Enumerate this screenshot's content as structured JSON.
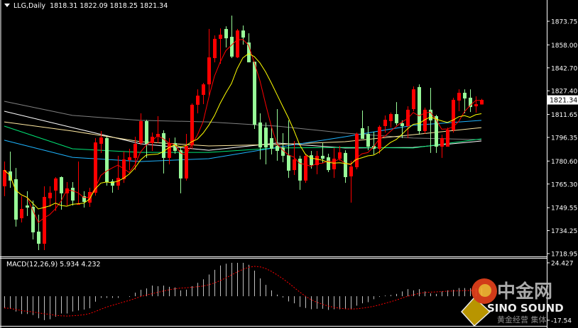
{
  "header": {
    "symbol": "LLG,Daily",
    "ohlc_text": "1818.31 1822.09 1818.25 1821.34"
  },
  "macd_label": "MACD(12,26,9) 5.934 4.232",
  "watermark": {
    "cn": "中金网",
    "en": "SINO SOUND",
    "sub": "黄金经营 集体"
  },
  "colors": {
    "background": "#000000",
    "bull_candle": "#ff0000",
    "bear_candle": "#98fb98",
    "ma_fast": "#ff0000",
    "ma_slow": "#ffff00",
    "ma_blue": "#1eb4ff",
    "ma_green": "#00e676",
    "ma_cream": "#ffe9a0",
    "ma_white": "#ffffff",
    "ma_gray": "#808080",
    "macd_hist": "#c0c0c0",
    "macd_signal": "#ff0000"
  },
  "chart_data": [
    {
      "type": "candlestick",
      "title": "LLG,Daily",
      "current_price": "1821.34",
      "y_ticks": [
        "1873.75",
        "1858.00",
        "1842.70",
        "1827.40",
        "1811.65",
        "1796.35",
        "1780.60",
        "1765.30",
        "1749.55",
        "1734.25",
        "1718.95"
      ],
      "ylim": [
        1718.95,
        1873.75
      ],
      "grid": false,
      "ohlc": [
        [
          1763.8,
          1780.3,
          1757.2,
          1774.6
        ],
        [
          1773.7,
          1786.9,
          1762.8,
          1767.6
        ],
        [
          1768.5,
          1776.0,
          1736.9,
          1741.6
        ],
        [
          1742.5,
          1757.2,
          1739.7,
          1748.7
        ],
        [
          1751.0,
          1760.5,
          1744.0,
          1749.6
        ],
        [
          1750.1,
          1754.3,
          1728.4,
          1733.1
        ],
        [
          1733.6,
          1744.9,
          1721.3,
          1725.5
        ],
        [
          1725.5,
          1763.8,
          1721.3,
          1756.7
        ],
        [
          1755.8,
          1763.8,
          1750.1,
          1759.5
        ],
        [
          1760.9,
          1769.9,
          1747.3,
          1769.0
        ],
        [
          1769.9,
          1770.4,
          1748.2,
          1759.1
        ],
        [
          1759.1,
          1766.6,
          1751.0,
          1762.4
        ],
        [
          1762.8,
          1766.6,
          1751.0,
          1754.3
        ],
        [
          1751.5,
          1780.3,
          1751.5,
          1752.4
        ],
        [
          1757.2,
          1760.5,
          1749.6,
          1753.4
        ],
        [
          1752.9,
          1762.8,
          1750.1,
          1760.0
        ],
        [
          1759.5,
          1795.9,
          1757.6,
          1793.0
        ],
        [
          1792.1,
          1800.6,
          1786.0,
          1796.3
        ],
        [
          1795.9,
          1796.8,
          1764.2,
          1766.6
        ],
        [
          1767.1,
          1768.5,
          1759.5,
          1764.2
        ],
        [
          1764.2,
          1784.1,
          1761.4,
          1769.4
        ],
        [
          1768.5,
          1786.9,
          1766.1,
          1781.7
        ],
        [
          1781.2,
          1788.8,
          1774.6,
          1783.1
        ],
        [
          1782.7,
          1796.8,
          1774.6,
          1792.1
        ],
        [
          1792.6,
          1812.4,
          1791.2,
          1807.2
        ],
        [
          1807.2,
          1808.1,
          1782.7,
          1792.1
        ],
        [
          1792.6,
          1799.6,
          1787.4,
          1796.8
        ],
        [
          1796.8,
          1810.5,
          1792.6,
          1798.7
        ],
        [
          1799.2,
          1801.1,
          1772.3,
          1782.7
        ],
        [
          1782.7,
          1795.9,
          1778.4,
          1792.6
        ],
        [
          1792.6,
          1796.3,
          1785.5,
          1787.4
        ],
        [
          1787.8,
          1790.2,
          1759.1,
          1769.0
        ],
        [
          1769.0,
          1798.7,
          1767.6,
          1790.7
        ],
        [
          1791.2,
          1819.0,
          1788.8,
          1818.1
        ],
        [
          1818.1,
          1828.4,
          1812.4,
          1824.2
        ],
        [
          1824.7,
          1832.7,
          1818.5,
          1831.7
        ],
        [
          1831.7,
          1868.6,
          1824.2,
          1849.7
        ],
        [
          1849.2,
          1864.3,
          1846.4,
          1862.0
        ],
        [
          1862.0,
          1869.0,
          1845.4,
          1864.8
        ],
        [
          1868.6,
          1870.4,
          1856.3,
          1862.4
        ],
        [
          1863.4,
          1877.5,
          1849.2,
          1850.2
        ],
        [
          1849.7,
          1868.6,
          1849.2,
          1867.6
        ],
        [
          1867.6,
          1870.9,
          1858.2,
          1862.9
        ],
        [
          1859.6,
          1865.7,
          1846.4,
          1846.4
        ],
        [
          1846.8,
          1846.8,
          1802.0,
          1804.8
        ],
        [
          1806.3,
          1812.4,
          1781.7,
          1789.7
        ],
        [
          1802.9,
          1806.3,
          1778.4,
          1789.7
        ],
        [
          1795.9,
          1802.9,
          1785.0,
          1788.8
        ],
        [
          1790.7,
          1815.2,
          1780.8,
          1787.4
        ],
        [
          1789.7,
          1799.2,
          1779.8,
          1784.1
        ],
        [
          1784.5,
          1807.7,
          1769.4,
          1774.2
        ],
        [
          1774.6,
          1794.0,
          1771.3,
          1781.7
        ],
        [
          1782.2,
          1784.1,
          1761.4,
          1767.6
        ],
        [
          1767.6,
          1785.5,
          1766.1,
          1784.1
        ],
        [
          1784.5,
          1787.4,
          1775.6,
          1777.9
        ],
        [
          1777.9,
          1787.4,
          1771.8,
          1784.1
        ],
        [
          1784.1,
          1792.6,
          1779.3,
          1782.2
        ],
        [
          1783.1,
          1785.5,
          1773.2,
          1774.6
        ],
        [
          1775.1,
          1789.3,
          1769.4,
          1782.2
        ],
        [
          1782.2,
          1790.7,
          1780.8,
          1786.4
        ],
        [
          1786.0,
          1787.8,
          1766.1,
          1769.9
        ],
        [
          1770.4,
          1780.8,
          1752.9,
          1777.0
        ],
        [
          1776.5,
          1799.6,
          1775.1,
          1798.7
        ],
        [
          1802.5,
          1814.3,
          1795.4,
          1795.4
        ],
        [
          1798.7,
          1803.9,
          1787.8,
          1790.2
        ],
        [
          1790.7,
          1800.1,
          1785.0,
          1788.8
        ],
        [
          1788.8,
          1804.4,
          1785.5,
          1803.4
        ],
        [
          1803.9,
          1811.0,
          1799.6,
          1808.1
        ],
        [
          1807.2,
          1812.9,
          1802.9,
          1811.9
        ],
        [
          1811.9,
          1819.9,
          1804.4,
          1805.8
        ],
        [
          1805.8,
          1807.7,
          1795.9,
          1803.9
        ],
        [
          1803.9,
          1817.1,
          1795.9,
          1814.8
        ],
        [
          1815.2,
          1830.3,
          1813.8,
          1828.4
        ],
        [
          1829.9,
          1831.7,
          1798.2,
          1800.6
        ],
        [
          1800.6,
          1816.2,
          1798.7,
          1814.8
        ],
        [
          1814.8,
          1829.4,
          1786.0,
          1807.7
        ],
        [
          1810.5,
          1811.4,
          1786.0,
          1790.2
        ],
        [
          1790.2,
          1798.2,
          1782.7,
          1795.9
        ],
        [
          1790.2,
          1802.9,
          1790.2,
          1801.5
        ],
        [
          1801.1,
          1822.8,
          1799.6,
          1821.4
        ],
        [
          1820.9,
          1828.4,
          1813.8,
          1826.1
        ],
        [
          1826.1,
          1828.4,
          1812.4,
          1822.3
        ],
        [
          1822.8,
          1828.4,
          1813.3,
          1816.6
        ],
        [
          1817.1,
          1823.7,
          1812.9,
          1818.5
        ],
        [
          1818.31,
          1822.09,
          1818.25,
          1821.34
        ]
      ],
      "moving_averages": {
        "fast_period": 5,
        "slow_period": 10,
        "long_lines_sampled_at_bars": [
          0,
          12,
          24,
          36,
          48,
          60,
          72,
          84
        ],
        "long_lines": [
          {
            "color_key": "ma_gray",
            "values": [
              1820.4,
              1811.0,
              1807.7,
              1806.7,
              1803.9,
              1799.2,
              1795.9,
              1794.9
            ]
          },
          {
            "color_key": "ma_white",
            "values": [
              1813.8,
              1802.9,
              1792.1,
              1787.8,
              1792.6,
              1789.3,
              1789.7,
              1794.0
            ]
          },
          {
            "color_key": "ma_cream",
            "values": [
              1806.7,
              1800.6,
              1793.5,
              1790.7,
              1791.6,
              1793.5,
              1798.2,
              1802.9
            ]
          },
          {
            "color_key": "ma_green",
            "values": [
              1803.9,
              1788.8,
              1786.4,
              1786.4,
              1789.3,
              1789.7,
              1789.3,
              1795.4
            ]
          },
          {
            "color_key": "ma_blue",
            "values": [
              1794.5,
              1783.1,
              1780.3,
              1782.2,
              1789.7,
              1796.8,
              1804.4,
              1807.7
            ]
          }
        ]
      }
    },
    {
      "type": "bar",
      "title": "MACD(12,26,9)",
      "macd_value": "5.934",
      "signal_value": "4.232",
      "y_ticks": [
        "24.427",
        "-17.54"
      ],
      "ylim": [
        -17.54,
        24.427
      ],
      "histogram": [
        -8.6,
        -9.2,
        -11.2,
        -13.0,
        -13.0,
        -13.8,
        -16.1,
        -17.5,
        -16.8,
        -15.0,
        -12.6,
        -12.6,
        -11.2,
        -10.4,
        -9.8,
        -8.8,
        -4.0,
        -1.2,
        -1.2,
        -1.2,
        -1.2,
        0.0,
        -0.5,
        2.6,
        4.7,
        5.7,
        7.8,
        7.3,
        7.8,
        6.9,
        6.4,
        4.3,
        4.8,
        7.4,
        9.8,
        12.4,
        15.9,
        19.3,
        22.5,
        23.8,
        24.4,
        24.4,
        24.4,
        23.0,
        18.7,
        13.0,
        8.3,
        4.3,
        1.2,
        -0.9,
        -3.8,
        -5.2,
        -7.8,
        -8.6,
        -9.5,
        -9.2,
        -9.2,
        -10.0,
        -9.5,
        -9.5,
        -9.5,
        -9.5,
        -6.9,
        -5.2,
        -4.3,
        -2.2,
        -0.5,
        0.5,
        0.9,
        1.7,
        3.5,
        5.2,
        4.3,
        5.2,
        3.5,
        2.1,
        1.7,
        3.5,
        4.3,
        4.7,
        6.0,
        6.0,
        5.9,
        5.9,
        5.934
      ],
      "signal_period": 9
    }
  ]
}
